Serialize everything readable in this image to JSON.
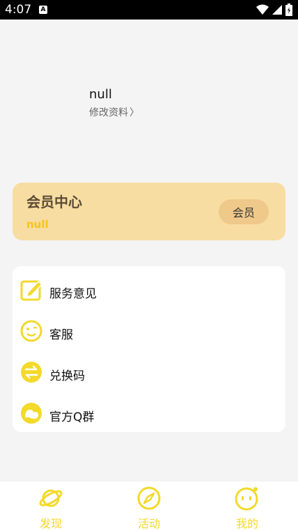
{
  "status_bar": {
    "time": "4:07",
    "app_icon_letter": "A"
  },
  "profile": {
    "name": "null",
    "edit_label": "修改资料",
    "edit_chevron": "〉"
  },
  "member_card": {
    "title": "会员中心",
    "subtitle": "null",
    "button_label": "会员"
  },
  "services": [
    {
      "label": "服务意见",
      "icon": "edit-note-icon"
    },
    {
      "label": "客服",
      "icon": "smile-face-icon"
    },
    {
      "label": "兑换码",
      "icon": "exchange-arrows-icon"
    },
    {
      "label": "官方Q群",
      "icon": "chat-bubbles-icon"
    }
  ],
  "bottom_nav": [
    {
      "label": "发现",
      "icon": "planet-icon"
    },
    {
      "label": "活动",
      "icon": "compass-icon"
    },
    {
      "label": "我的",
      "icon": "face-icon",
      "selected": true
    }
  ],
  "colors": {
    "accent_yellow": "#f3d92a",
    "member_card_bg": "#f8dda2",
    "member_button_bg": "#efc98a",
    "page_bg": "#f4f4f4"
  }
}
